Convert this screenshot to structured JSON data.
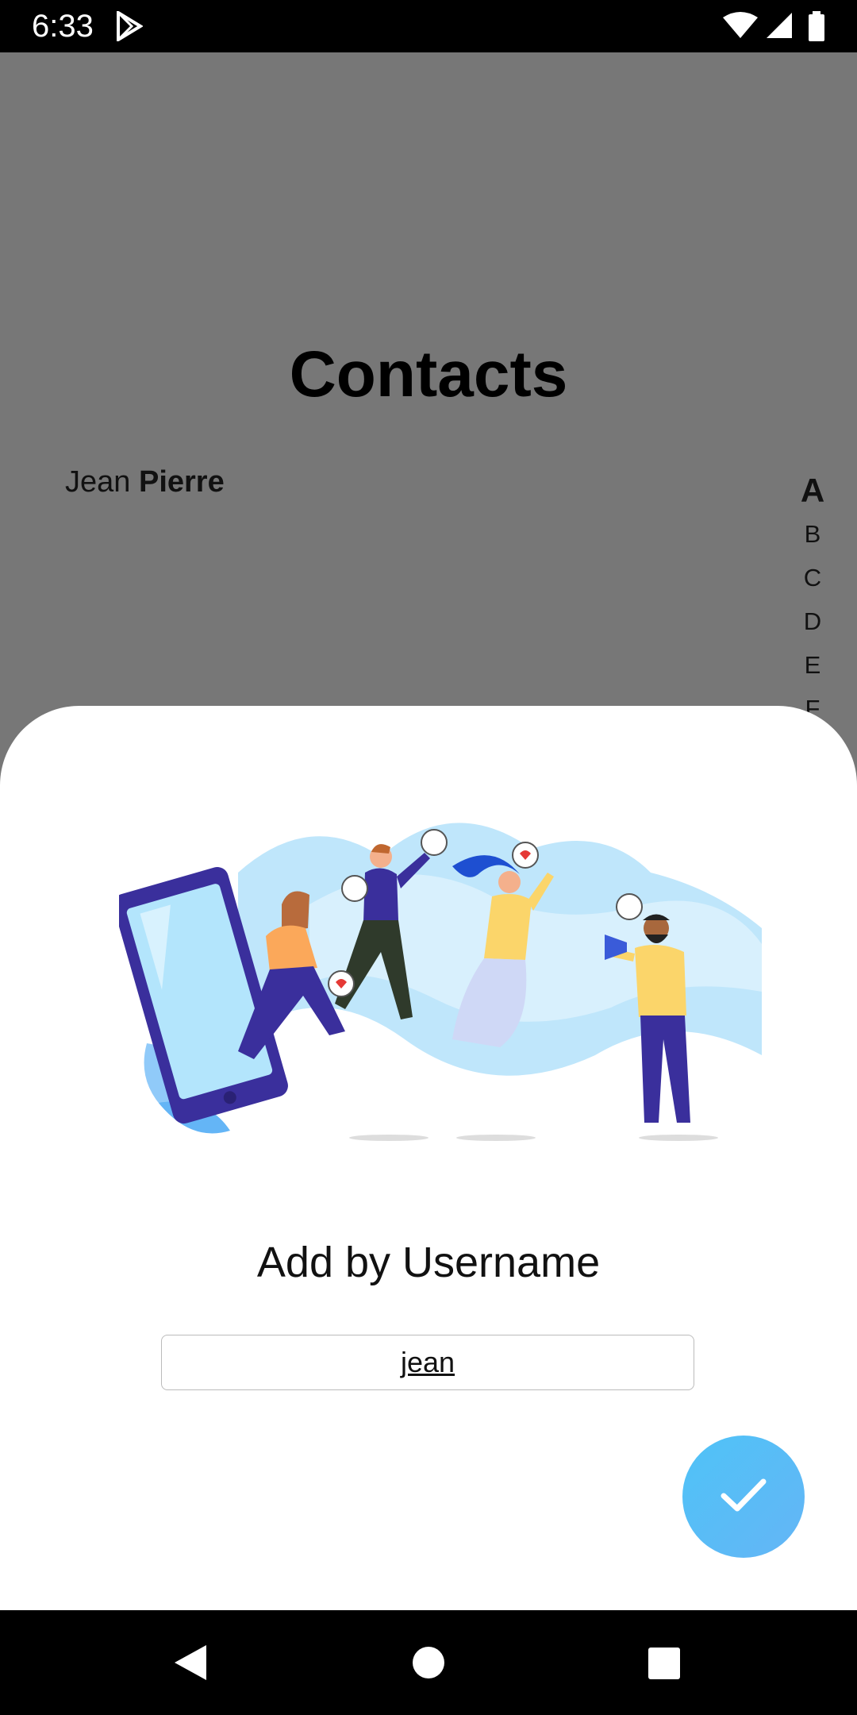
{
  "status_bar": {
    "time": "6:33",
    "icons": [
      "play-store-icon",
      "wifi-icon",
      "signal-icon",
      "battery-icon"
    ]
  },
  "contacts": {
    "title": "Contacts",
    "items": [
      {
        "first_name": "Jean",
        "last_name": "Pierre"
      }
    ],
    "alpha_index": [
      "A",
      "B",
      "C",
      "D",
      "E",
      "F"
    ],
    "alpha_active": "A"
  },
  "sheet": {
    "title": "Add by Username",
    "username_value": "jean",
    "confirm_icon": "check-icon"
  },
  "colors": {
    "scrim": "#777777",
    "fab_gradient_start": "#4fc3f7",
    "fab_gradient_end": "#64b5f6",
    "illustration_accent": "#3a2f9c"
  },
  "nav_bar": {
    "icons": [
      "back-icon",
      "home-icon",
      "recents-icon"
    ]
  }
}
